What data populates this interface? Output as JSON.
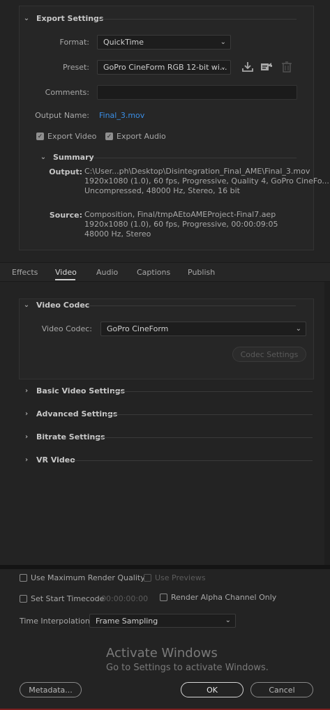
{
  "export_settings": {
    "title": "Export Settings",
    "format_label": "Format:",
    "format_value": "QuickTime",
    "preset_label": "Preset:",
    "preset_value": "GoPro CineForm RGB 12-bit wi...",
    "comments_label": "Comments:",
    "comments_value": "",
    "output_name_label": "Output Name:",
    "output_name_value": "Final_3.mov",
    "export_video_label": "Export Video",
    "export_video_checked": true,
    "export_audio_label": "Export Audio",
    "export_audio_checked": true
  },
  "summary": {
    "title": "Summary",
    "output_label": "Output:",
    "output_lines": [
      "C:\\User...ph\\Desktop\\Disintegration_Final_AME\\Final_3.mov",
      "1920x1080 (1.0), 60 fps, Progressive, Quality 4, GoPro CineFo...",
      "Uncompressed, 48000 Hz, Stereo, 16 bit"
    ],
    "source_label": "Source:",
    "source_lines": [
      "Composition, Final/tmpAEtoAMEProject-Final7.aep",
      "1920x1080 (1.0), 60 fps, Progressive, 00:00:09:05",
      "48000 Hz, Stereo"
    ]
  },
  "tabs": [
    "Effects",
    "Video",
    "Audio",
    "Captions",
    "Publish"
  ],
  "active_tab": "Video",
  "video_codec": {
    "title": "Video Codec",
    "codec_label": "Video Codec:",
    "codec_value": "GoPro CineForm",
    "codec_settings_label": "Codec Settings"
  },
  "collapsed_sections": [
    "Basic Video Settings",
    "Advanced Settings",
    "Bitrate Settings",
    "VR Video"
  ],
  "bottom": {
    "max_render_quality_label": "Use Maximum Render Quality",
    "use_previews_label": "Use Previews",
    "set_start_timecode_label": "Set Start Timecode",
    "timecode_value": "00:00:00:00",
    "render_alpha_label": "Render Alpha Channel Only",
    "time_interpolation_label": "Time Interpolation:",
    "time_interpolation_value": "Frame Sampling"
  },
  "watermark": {
    "title": "Activate Windows",
    "subtitle": "Go to Settings to activate Windows."
  },
  "buttons": {
    "metadata": "Metadata...",
    "ok": "OK",
    "cancel": "Cancel"
  },
  "colors": {
    "background": "#232323",
    "link": "#3a8ee6"
  }
}
